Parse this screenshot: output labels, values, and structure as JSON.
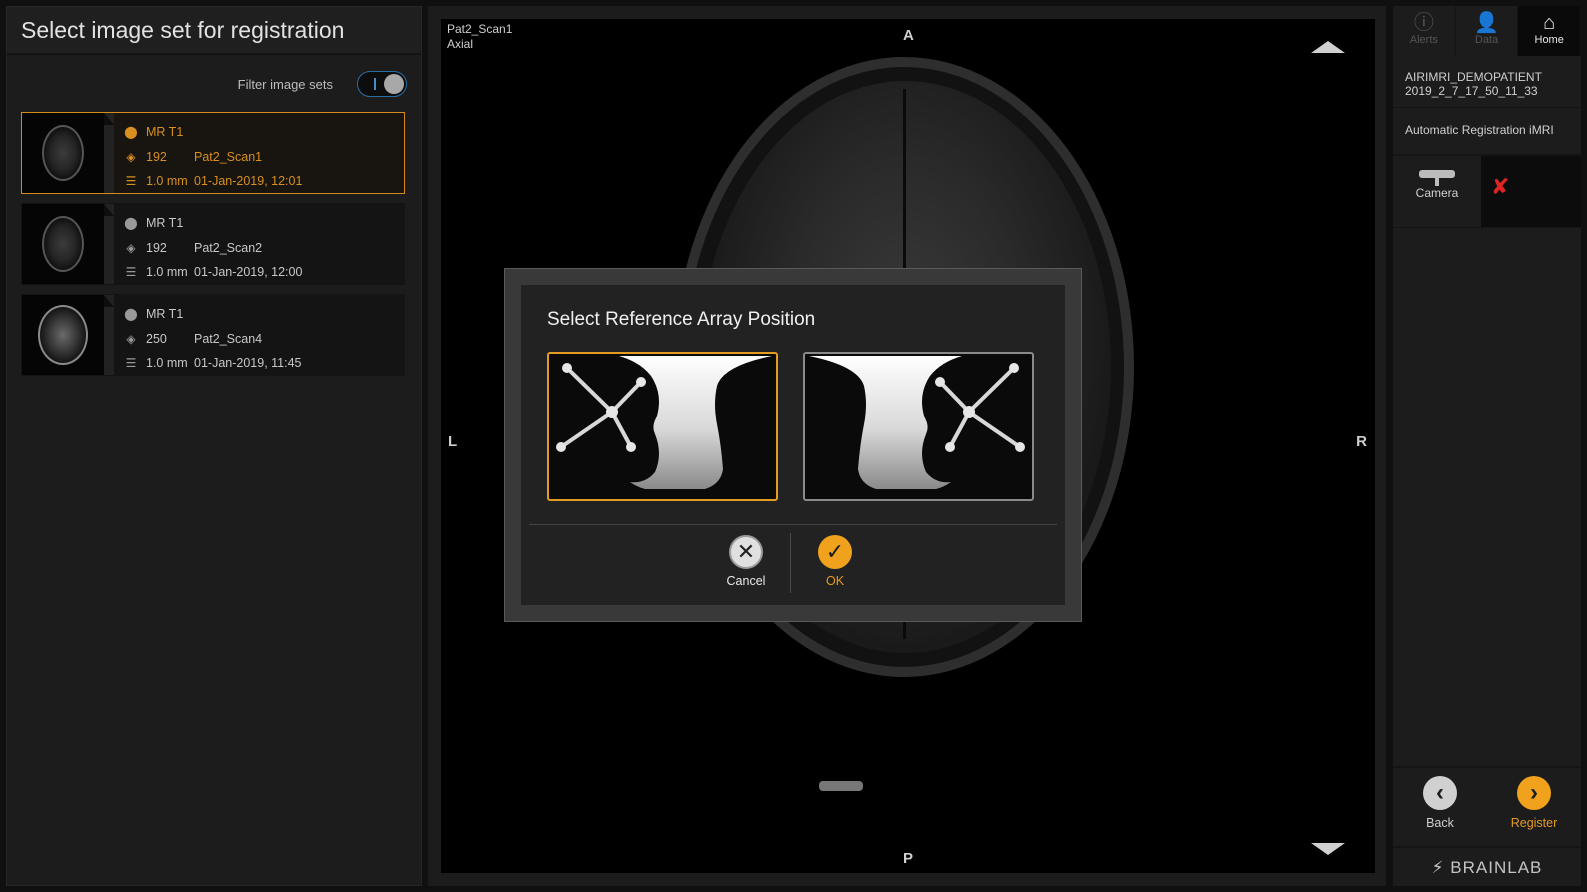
{
  "left_panel": {
    "title": "Select image set for registration",
    "filter_label": "Filter image sets",
    "image_sets": [
      {
        "modality": "MR T1",
        "slices": "192",
        "name": "Pat2_Scan1",
        "thickness": "1.0 mm",
        "date": "01-Jan-2019, 12:01",
        "selected": true
      },
      {
        "modality": "MR T1",
        "slices": "192",
        "name": "Pat2_Scan2",
        "thickness": "1.0 mm",
        "date": "01-Jan-2019, 12:00",
        "selected": false
      },
      {
        "modality": "MR T1",
        "slices": "250",
        "name": "Pat2_Scan4",
        "thickness": "1.0 mm",
        "date": "01-Jan-2019, 11:45",
        "selected": false
      }
    ]
  },
  "viewer": {
    "scan_name": "Pat2_Scan1",
    "view": "Axial",
    "orient_top": "A",
    "orient_bottom": "P",
    "orient_left": "L",
    "orient_right": "R"
  },
  "dialog": {
    "title": "Select Reference Array Position",
    "cancel_label": "Cancel",
    "ok_label": "OK",
    "selected_option": "left"
  },
  "right_panel": {
    "tabs": [
      {
        "label": "Alerts",
        "icon": "info-icon"
      },
      {
        "label": "Data",
        "icon": "data-icon"
      },
      {
        "label": "Home",
        "icon": "home-icon"
      }
    ],
    "patient_line1": "AIRIMRI_DEMOPATIENT",
    "patient_line2": "2019_2_7_17_50_11_33",
    "workflow": "Automatic Registration iMRI",
    "camera_label": "Camera",
    "camera_status": "disconnected",
    "back_label": "Back",
    "register_label": "Register",
    "brand": "BRAINLAB"
  },
  "colors": {
    "accent": "#e59a22",
    "error": "#e02424"
  }
}
